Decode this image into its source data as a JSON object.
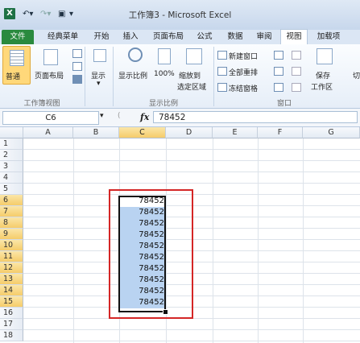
{
  "window": {
    "title": "工作簿3 - Microsoft Excel",
    "app_icon": "X",
    "qat": {
      "save_icon": "save-icon",
      "undo_icon": "undo-icon",
      "redo_icon": "redo-icon"
    }
  },
  "tabs": [
    "文件",
    "经典菜单",
    "开始",
    "插入",
    "页面布局",
    "公式",
    "数据",
    "审阅",
    "视图",
    "加载项"
  ],
  "active_tab": "视图",
  "ribbon": {
    "workbook_views": {
      "label": "工作簿视图",
      "normal": "普通",
      "page_layout": "页面布局"
    },
    "show": {
      "label": "显示"
    },
    "zoom": {
      "label": "显示比例",
      "zoom": "显示比例",
      "hundred": "100%",
      "zoom_to_selection_line1": "缩放到",
      "zoom_to_selection_line2": "选定区域"
    },
    "window": {
      "label": "窗口",
      "new_window": "新建窗口",
      "arrange_all": "全部重排",
      "freeze_panes": "冻结窗格",
      "save_workspace_line1": "保存",
      "save_workspace_line2": "工作区",
      "cut_off": "切"
    }
  },
  "formula_bar": {
    "name_box": "C6",
    "fx": "fx",
    "value": "78452"
  },
  "sheet": {
    "columns": [
      "A",
      "B",
      "C",
      "D",
      "E",
      "F",
      "G"
    ],
    "rows": [
      "1",
      "2",
      "3",
      "4",
      "5",
      "6",
      "7",
      "8",
      "9",
      "10",
      "11",
      "12",
      "13",
      "14",
      "15",
      "16",
      "17",
      "18"
    ],
    "cells_C6_C15": [
      "78452",
      "78452",
      "78452",
      "78452",
      "78452",
      "78452",
      "78452",
      "78452",
      "78452",
      "78452"
    ],
    "selected_column": "C",
    "selected_rows": [
      "6",
      "7",
      "8",
      "9",
      "10",
      "11",
      "12",
      "13",
      "14",
      "15"
    ],
    "colors": {
      "selection_fill": "#b9d3f1",
      "annotation_box": "#d42626",
      "file_tab": "#2a8a3e"
    }
  }
}
